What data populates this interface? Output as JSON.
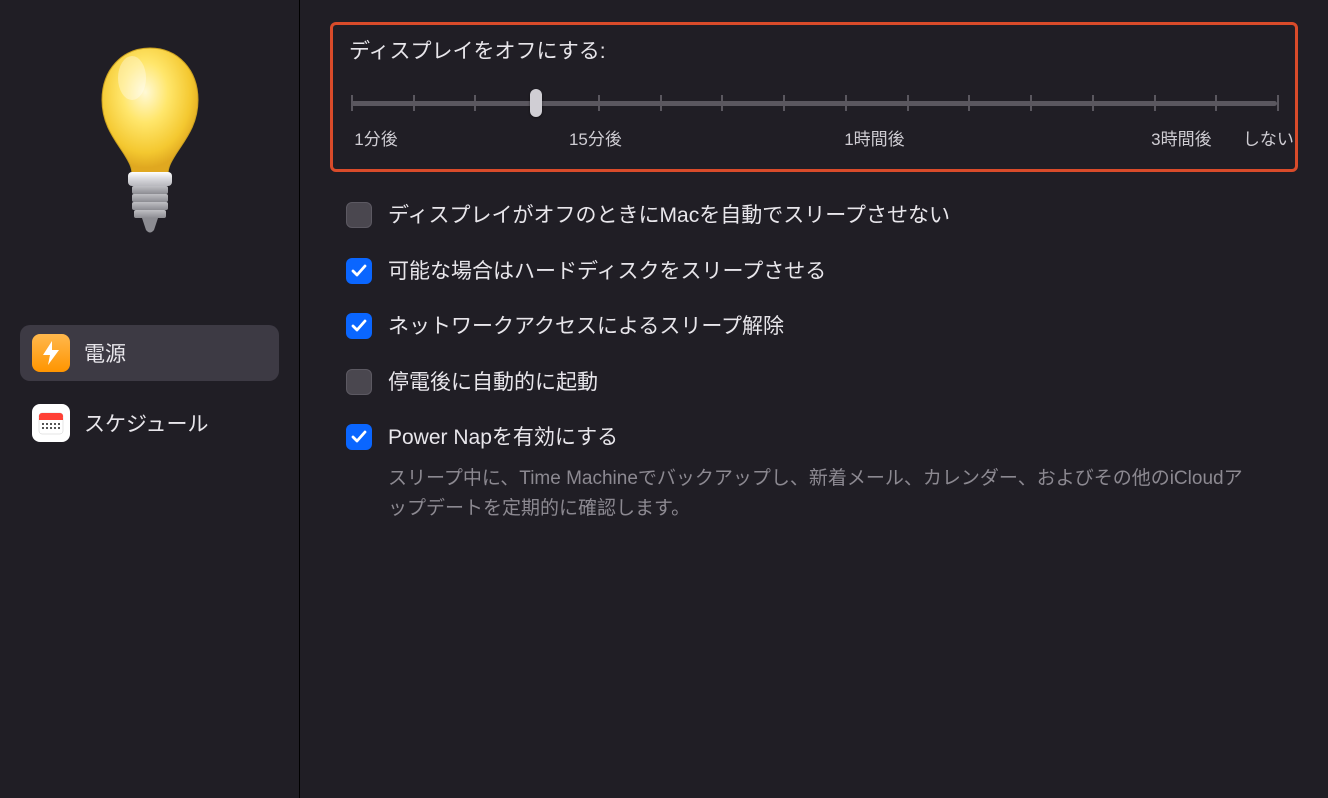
{
  "sidebar": {
    "items": [
      {
        "label": "電源",
        "selected": true
      },
      {
        "label": "スケジュール",
        "selected": false
      }
    ]
  },
  "main": {
    "slider": {
      "title": "ディスプレイをオフにする:",
      "thumb_position_percent": 20.0,
      "tick_count": 16,
      "labels": {
        "min1": "1分後",
        "min15": "15分後",
        "hr1": "1時間後",
        "hr3": "3時間後",
        "never": "しない"
      },
      "label_positions": {
        "min1": 1.5,
        "min15": 26.5,
        "hr1": 56.5,
        "hr3": 89.5,
        "never": 100.5
      }
    },
    "options": [
      {
        "label": "ディスプレイがオフのときにMacを自動でスリープさせない",
        "checked": false
      },
      {
        "label": "可能な場合はハードディスクをスリープさせる",
        "checked": true
      },
      {
        "label": "ネットワークアクセスによるスリープ解除",
        "checked": true
      },
      {
        "label": "停電後に自動的に起動",
        "checked": false
      },
      {
        "label": "Power Napを有効にする",
        "checked": true,
        "description": "スリープ中に、Time Machineでバックアップし、新着メール、カレンダー、およびその他のiCloudアップデートを定期的に確認します。"
      }
    ]
  }
}
